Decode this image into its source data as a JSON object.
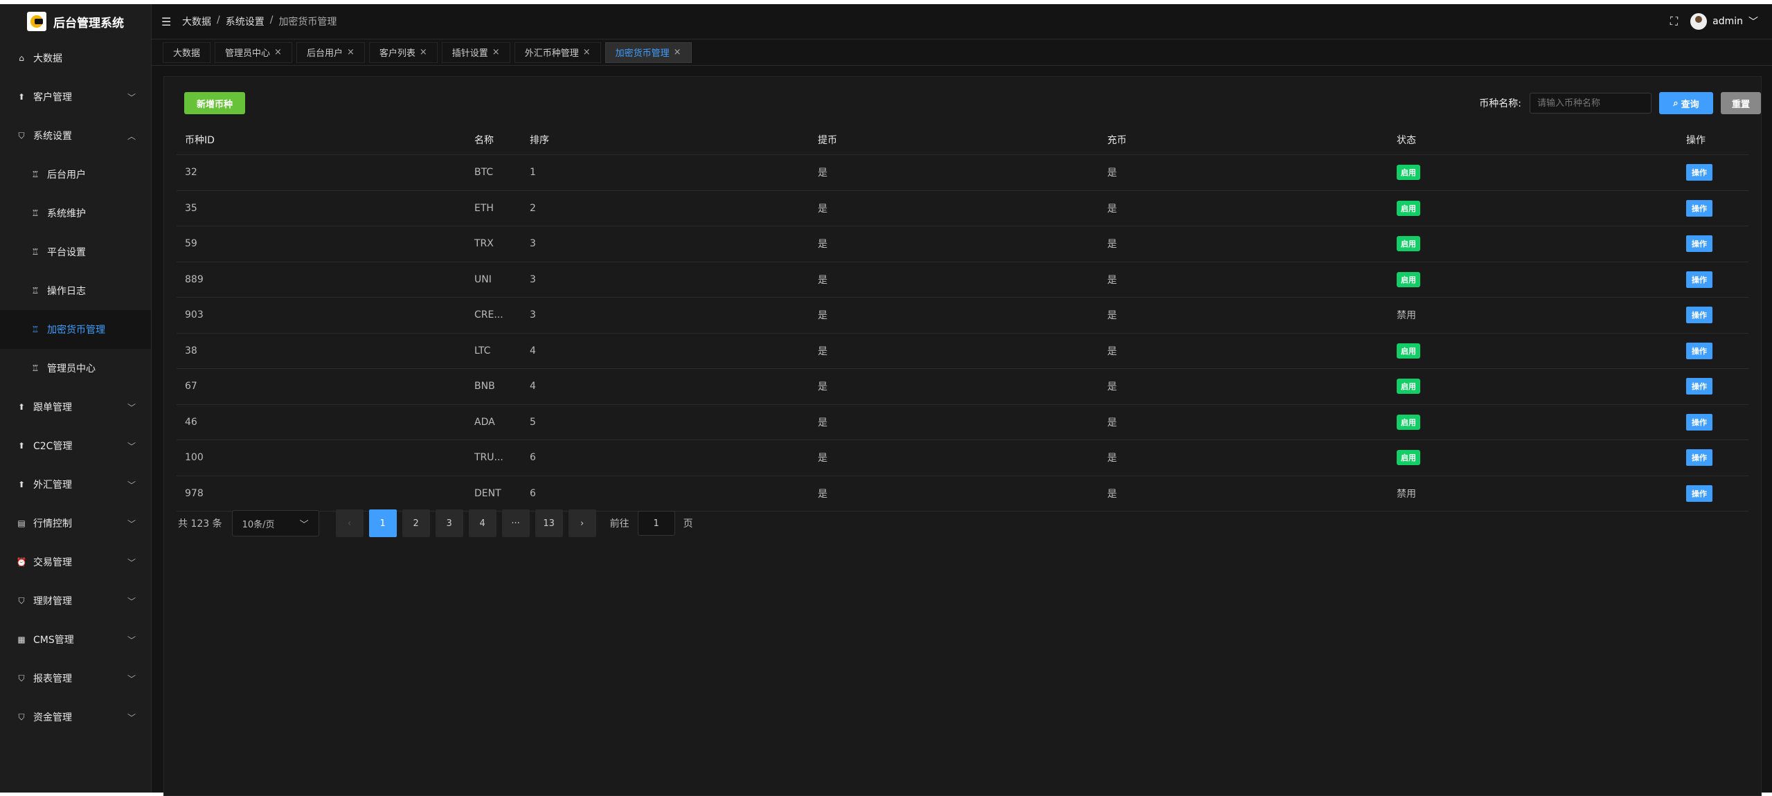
{
  "app": {
    "title": "后台管理系统"
  },
  "sidebar": {
    "items": [
      {
        "label": "大数据",
        "icon": "home-icon",
        "level": "top",
        "expandable": false
      },
      {
        "label": "客户管理",
        "icon": "upload-icon",
        "level": "top",
        "expandable": true,
        "chevron": "﹀"
      },
      {
        "label": "系统设置",
        "icon": "shield-icon",
        "level": "top",
        "expandable": true,
        "chevron": "︿"
      },
      {
        "label": "后台用户",
        "icon": "thumb-icon",
        "level": "sub",
        "expandable": false
      },
      {
        "label": "系统维护",
        "icon": "thumb-icon",
        "level": "sub",
        "expandable": false
      },
      {
        "label": "平台设置",
        "icon": "thumb-icon",
        "level": "sub",
        "expandable": false
      },
      {
        "label": "操作日志",
        "icon": "thumb-icon",
        "level": "sub",
        "expandable": false
      },
      {
        "label": "加密货币管理",
        "icon": "thumb-icon",
        "level": "sub",
        "expandable": false,
        "active": true
      },
      {
        "label": "管理员中心",
        "icon": "thumb-icon",
        "level": "sub",
        "expandable": false
      },
      {
        "label": "跟单管理",
        "icon": "upload-icon",
        "level": "top",
        "expandable": true,
        "chevron": "﹀"
      },
      {
        "label": "C2C管理",
        "icon": "upload-icon",
        "level": "top",
        "expandable": true,
        "chevron": "﹀"
      },
      {
        "label": "外汇管理",
        "icon": "upload-icon",
        "level": "top",
        "expandable": true,
        "chevron": "﹀"
      },
      {
        "label": "行情控制",
        "icon": "chart-icon",
        "level": "top",
        "expandable": true,
        "chevron": "﹀"
      },
      {
        "label": "交易管理",
        "icon": "alarm-icon",
        "level": "top",
        "expandable": true,
        "chevron": "﹀"
      },
      {
        "label": "理财管理",
        "icon": "shield-icon",
        "level": "top",
        "expandable": true,
        "chevron": "﹀"
      },
      {
        "label": "CMS管理",
        "icon": "layout-icon",
        "level": "top",
        "expandable": true,
        "chevron": "﹀"
      },
      {
        "label": "报表管理",
        "icon": "shield-icon",
        "level": "top",
        "expandable": true,
        "chevron": "﹀"
      },
      {
        "label": "资金管理",
        "icon": "shield-icon",
        "level": "top",
        "expandable": true,
        "chevron": "﹀"
      }
    ]
  },
  "header": {
    "breadcrumb": [
      "大数据",
      "系统设置",
      "加密货币管理"
    ],
    "separator": "/",
    "user": "admin"
  },
  "tabs": [
    {
      "label": "大数据",
      "closable": false
    },
    {
      "label": "管理员中心",
      "closable": true
    },
    {
      "label": "后台用户",
      "closable": true
    },
    {
      "label": "客户列表",
      "closable": true
    },
    {
      "label": "插针设置",
      "closable": true
    },
    {
      "label": "外汇币种管理",
      "closable": true
    },
    {
      "label": "加密货币管理",
      "closable": true,
      "active": true
    }
  ],
  "toolbar": {
    "add_label": "新增币种",
    "search_label": "币种名称:",
    "search_placeholder": "请输入币种名称",
    "query_label": "查询",
    "reset_label": "重置"
  },
  "table": {
    "columns": [
      "币种ID",
      "名称",
      "排序",
      "提币",
      "充币",
      "状态",
      "操作"
    ],
    "rows": [
      {
        "id": "32",
        "name": "BTC",
        "sort": "1",
        "withdraw": "是",
        "deposit": "是",
        "status": "启用",
        "enabled": true,
        "action": "操作"
      },
      {
        "id": "35",
        "name": "ETH",
        "sort": "2",
        "withdraw": "是",
        "deposit": "是",
        "status": "启用",
        "enabled": true,
        "action": "操作"
      },
      {
        "id": "59",
        "name": "TRX",
        "sort": "3",
        "withdraw": "是",
        "deposit": "是",
        "status": "启用",
        "enabled": true,
        "action": "操作"
      },
      {
        "id": "889",
        "name": "UNI",
        "sort": "3",
        "withdraw": "是",
        "deposit": "是",
        "status": "启用",
        "enabled": true,
        "action": "操作"
      },
      {
        "id": "903",
        "name": "CRE...",
        "sort": "3",
        "withdraw": "是",
        "deposit": "是",
        "status": "禁用",
        "enabled": false,
        "action": "操作"
      },
      {
        "id": "38",
        "name": "LTC",
        "sort": "4",
        "withdraw": "是",
        "deposit": "是",
        "status": "启用",
        "enabled": true,
        "action": "操作"
      },
      {
        "id": "67",
        "name": "BNB",
        "sort": "4",
        "withdraw": "是",
        "deposit": "是",
        "status": "启用",
        "enabled": true,
        "action": "操作"
      },
      {
        "id": "46",
        "name": "ADA",
        "sort": "5",
        "withdraw": "是",
        "deposit": "是",
        "status": "启用",
        "enabled": true,
        "action": "操作"
      },
      {
        "id": "100",
        "name": "TRU...",
        "sort": "6",
        "withdraw": "是",
        "deposit": "是",
        "status": "启用",
        "enabled": true,
        "action": "操作"
      },
      {
        "id": "978",
        "name": "DENT",
        "sort": "6",
        "withdraw": "是",
        "deposit": "是",
        "status": "禁用",
        "enabled": false,
        "action": "操作"
      }
    ]
  },
  "pagination": {
    "total_text": "共 123 条",
    "page_size": "10条/页",
    "prev": "‹",
    "next": "›",
    "pages": [
      "1",
      "2",
      "3",
      "4",
      "···",
      "13"
    ],
    "current": "1",
    "goto_prefix": "前往",
    "goto_value": "1",
    "goto_suffix": "页"
  },
  "colors": {
    "accent": "#409eff",
    "success": "#67c23a",
    "status_on": "#13ce66",
    "background": "#141414"
  }
}
